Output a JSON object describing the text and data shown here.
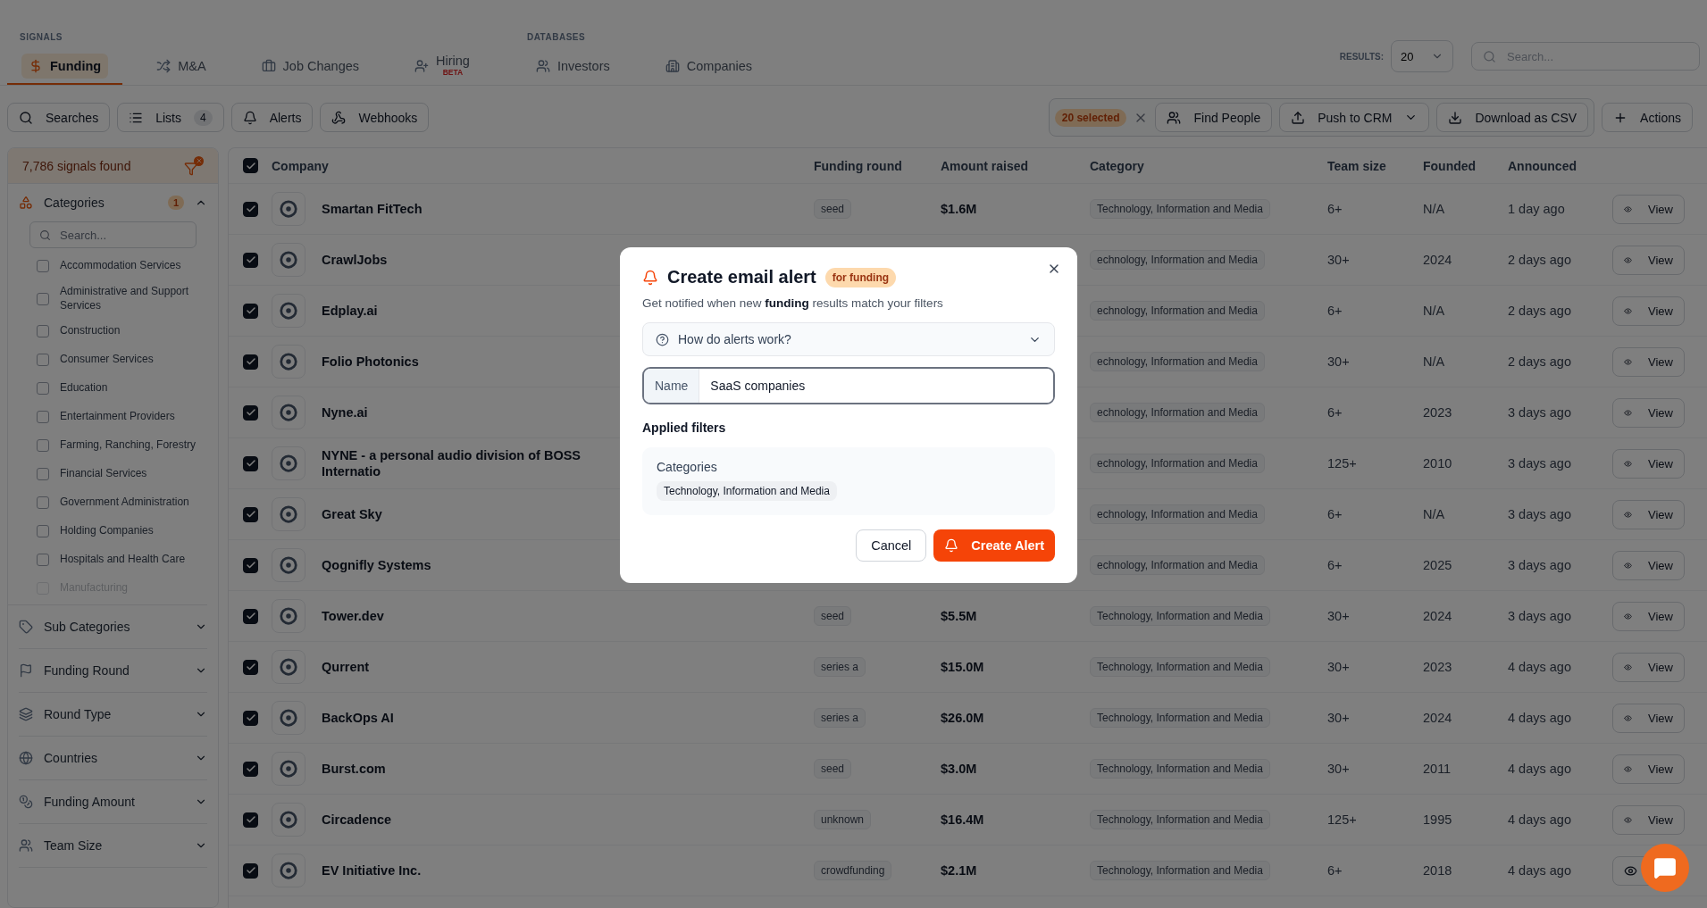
{
  "nav": {
    "groups": [
      {
        "label": "SIGNALS",
        "tabs": [
          {
            "kind": "dollar",
            "label": "Funding",
            "selected": true
          },
          {
            "kind": "shuffle",
            "label": "M&A",
            "selected": false
          },
          {
            "kind": "briefcase",
            "label": "Job Changes",
            "selected": false
          },
          {
            "kind": "user-plus",
            "label": "Hiring",
            "badge": "BETA",
            "selected": false
          }
        ]
      },
      {
        "label": "DATABASES",
        "tabs": [
          {
            "kind": "users",
            "label": "Investors",
            "selected": false
          },
          {
            "kind": "building",
            "label": "Companies",
            "selected": false
          }
        ]
      }
    ],
    "results_label": "RESULTS:",
    "results_value": "20",
    "search_placeholder": "Search..."
  },
  "toolbar": {
    "buttons": [
      {
        "kind": "search",
        "label": "Searches"
      },
      {
        "kind": "list",
        "label": "Lists",
        "count": "4"
      },
      {
        "kind": "bell",
        "label": "Alerts"
      },
      {
        "kind": "webhook",
        "label": "Webhooks"
      }
    ],
    "selection": {
      "count": "20 selected",
      "actions": [
        {
          "kind": "people",
          "label": "Find People"
        },
        {
          "kind": "upload",
          "label": "Push to CRM",
          "dropdown": true
        },
        {
          "kind": "download",
          "label": "Download as CSV"
        }
      ]
    },
    "actions_button": "Actions"
  },
  "sidebar": {
    "summary": "7,786 signals found",
    "search_placeholder": "Search...",
    "sections": [
      {
        "kind": "shapes",
        "label": "Categories",
        "count": "1",
        "expanded": true,
        "options": [
          {
            "label": "Accommodation Services",
            "checked": false
          },
          {
            "label": "Administrative and Support Services",
            "checked": false
          },
          {
            "label": "Construction",
            "checked": false
          },
          {
            "label": "Consumer Services",
            "checked": false
          },
          {
            "label": "Education",
            "checked": false
          },
          {
            "label": "Entertainment Providers",
            "checked": false
          },
          {
            "label": "Farming, Ranching, Forestry",
            "checked": false
          },
          {
            "label": "Financial Services",
            "checked": false
          },
          {
            "label": "Government Administration",
            "checked": false
          },
          {
            "label": "Holding Companies",
            "checked": false
          },
          {
            "label": "Hospitals and Health Care",
            "checked": false
          },
          {
            "label": "Manufacturing",
            "checked": false
          }
        ]
      },
      {
        "kind": "tag",
        "label": "Sub Categories",
        "expanded": false
      },
      {
        "kind": "flag",
        "label": "Funding Round",
        "expanded": false
      },
      {
        "kind": "layers",
        "label": "Round Type",
        "expanded": false
      },
      {
        "kind": "globe",
        "label": "Countries",
        "expanded": false
      },
      {
        "kind": "coins",
        "label": "Funding Amount",
        "expanded": false
      },
      {
        "kind": "users",
        "label": "Team Size",
        "expanded": false
      }
    ]
  },
  "table": {
    "all_checked": true,
    "columns": [
      "Company",
      "Funding round",
      "Amount raised",
      "Category",
      "Team size",
      "Founded",
      "Announced"
    ],
    "rows": [
      {
        "checked": true,
        "company": "Smartan FitTech",
        "round": "seed",
        "amount": "$1.6M",
        "category": "Technology, Information and Media",
        "team": "6+",
        "founded": "N/A",
        "announced": "1 day ago",
        "action": "View"
      },
      {
        "checked": true,
        "company": "CrawlJobs",
        "category": "echnology, Information and Media",
        "team": "30+",
        "founded": "2024",
        "announced": "2 days ago",
        "action": "View"
      },
      {
        "checked": true,
        "company": "Edplay.ai",
        "category": "echnology, Information and Media",
        "team": "6+",
        "founded": "N/A",
        "announced": "2 days ago",
        "action": "View"
      },
      {
        "checked": true,
        "company": "Folio Photonics",
        "category": "echnology, Information and Media",
        "team": "30+",
        "founded": "N/A",
        "announced": "2 days ago",
        "action": "View"
      },
      {
        "checked": true,
        "company": "Nyne.ai",
        "category": "echnology, Information and Media",
        "team": "6+",
        "founded": "2023",
        "announced": "3 days ago",
        "action": "View"
      },
      {
        "checked": true,
        "company": "NYNE - a personal audio division of BOSS Internatio",
        "category": "echnology, Information and Media",
        "team": "125+",
        "founded": "2010",
        "announced": "3 days ago",
        "action": "View"
      },
      {
        "checked": true,
        "company": "Great Sky",
        "category": "echnology, Information and Media",
        "team": "6+",
        "founded": "N/A",
        "announced": "3 days ago",
        "action": "View"
      },
      {
        "checked": true,
        "company": "Qognifly Systems",
        "category": "echnology, Information and Media",
        "team": "6+",
        "founded": "2025",
        "announced": "3 days ago",
        "action": "View"
      },
      {
        "checked": true,
        "company": "Tower.dev",
        "round": "seed",
        "amount": "$5.5M",
        "category": "Technology, Information and Media",
        "team": "30+",
        "founded": "2024",
        "announced": "3 days ago",
        "action": "View"
      },
      {
        "checked": true,
        "company": "Qurrent",
        "round": "series a",
        "amount": "$15.0M",
        "category": "Technology, Information and Media",
        "team": "30+",
        "founded": "2023",
        "announced": "4 days ago",
        "action": "View"
      },
      {
        "checked": true,
        "company": "BackOps AI",
        "round": "series a",
        "amount": "$26.0M",
        "category": "Technology, Information and Media",
        "team": "30+",
        "founded": "2024",
        "announced": "4 days ago",
        "action": "View"
      },
      {
        "checked": true,
        "company": "Burst.com",
        "round": "seed",
        "amount": "$3.0M",
        "category": "Technology, Information and Media",
        "team": "30+",
        "founded": "2011",
        "announced": "4 days ago",
        "action": "View"
      },
      {
        "checked": true,
        "company": "Circadence",
        "round": "unknown",
        "amount": "$16.4M",
        "category": "Technology, Information and Media",
        "team": "125+",
        "founded": "1995",
        "announced": "4 days ago",
        "action": "View"
      },
      {
        "checked": true,
        "company": "EV Initiative Inc.",
        "round": "crowdfunding",
        "amount": "$2.1M",
        "category": "Technology, Information and Media",
        "team": "6+",
        "founded": "2018",
        "announced": "4 days ago"
      }
    ]
  },
  "modal": {
    "title": "Create email alert",
    "badge": "for funding",
    "subtitle": "Get notified when new **funding** results match your filters",
    "help": {
      "label": "How do alerts work?",
      "expanded": false
    },
    "name_label": "Name",
    "name_value": "SaaS companies",
    "applied_title": "Applied filters",
    "filters": [
      {
        "group": "Categories",
        "values": [
          "Technology, Information and Media"
        ]
      }
    ],
    "cancel": "Cancel",
    "submit": "Create Alert"
  }
}
